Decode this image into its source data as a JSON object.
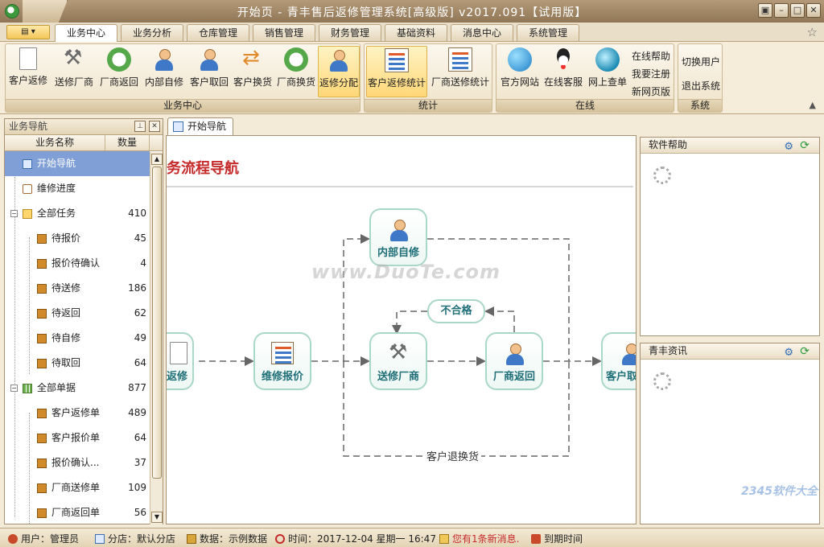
{
  "window": {
    "title": "开始页 - 青丰售后返修管理系统[高级版] v2017.091【试用版】"
  },
  "menu": {
    "tabs": [
      "业务中心",
      "业务分析",
      "仓库管理",
      "销售管理",
      "财务管理",
      "基础资料",
      "消息中心",
      "系统管理"
    ],
    "active": "业务中心"
  },
  "ribbon": {
    "groups": {
      "business": "业务中心",
      "stats": "统计",
      "online": "在线",
      "system": "系统"
    },
    "business_buttons": [
      "客户返修",
      "送修厂商",
      "厂商返回",
      "内部自修",
      "客户取回",
      "客户换货",
      "厂商换货",
      "返修分配"
    ],
    "stats_buttons": [
      "客户返修统计",
      "厂商送修统计"
    ],
    "online_buttons": [
      "官方网站",
      "在线客服",
      "网上查单"
    ],
    "online_links": [
      "在线帮助",
      "我要注册",
      "新网页版"
    ],
    "system_links": [
      "切换用户",
      "退出系统"
    ]
  },
  "sidebar": {
    "title": "业务导航",
    "col_name": "业务名称",
    "col_count": "数量",
    "items": [
      {
        "label": "开始导航",
        "count": "",
        "level": 0
      },
      {
        "label": "维修进度",
        "count": "",
        "level": 0
      },
      {
        "label": "全部任务",
        "count": "410",
        "level": 0
      },
      {
        "label": "待报价",
        "count": "45",
        "level": 1
      },
      {
        "label": "报价待确认",
        "count": "4",
        "level": 1
      },
      {
        "label": "待送修",
        "count": "186",
        "level": 1
      },
      {
        "label": "待返回",
        "count": "62",
        "level": 1
      },
      {
        "label": "待自修",
        "count": "49",
        "level": 1
      },
      {
        "label": "待取回",
        "count": "64",
        "level": 1
      },
      {
        "label": "全部单据",
        "count": "877",
        "level": 0
      },
      {
        "label": "客户返修单",
        "count": "489",
        "level": 1
      },
      {
        "label": "客户报价单",
        "count": "64",
        "level": 1
      },
      {
        "label": "报价确认...",
        "count": "37",
        "level": 1
      },
      {
        "label": "厂商送修单",
        "count": "109",
        "level": 1
      },
      {
        "label": "厂商返回单",
        "count": "56",
        "level": 1
      }
    ]
  },
  "doc_tab": "开始导航",
  "flow": {
    "title": "务流程导航",
    "nodes": {
      "customer_repair": "返修",
      "quote": "维修报价",
      "internal": "内部自修",
      "send_vendor": "送修厂商",
      "vendor_return": "厂商返回",
      "customer_pick": "客户取",
      "unqualified": "不合格"
    },
    "return_label": "客户退换货",
    "watermark": "www.DuoTe.com"
  },
  "right": {
    "help_title": "软件帮助",
    "news_title": "青丰资讯"
  },
  "status": {
    "user": "用户：管理员",
    "branch": "分店：默认分店",
    "data": "数据：示例数据",
    "time": "时间：2017-12-04 星期一 16:47",
    "message": "您有1条新消息.",
    "expire": "到期时间"
  },
  "corner_logo": "2345软件大全"
}
